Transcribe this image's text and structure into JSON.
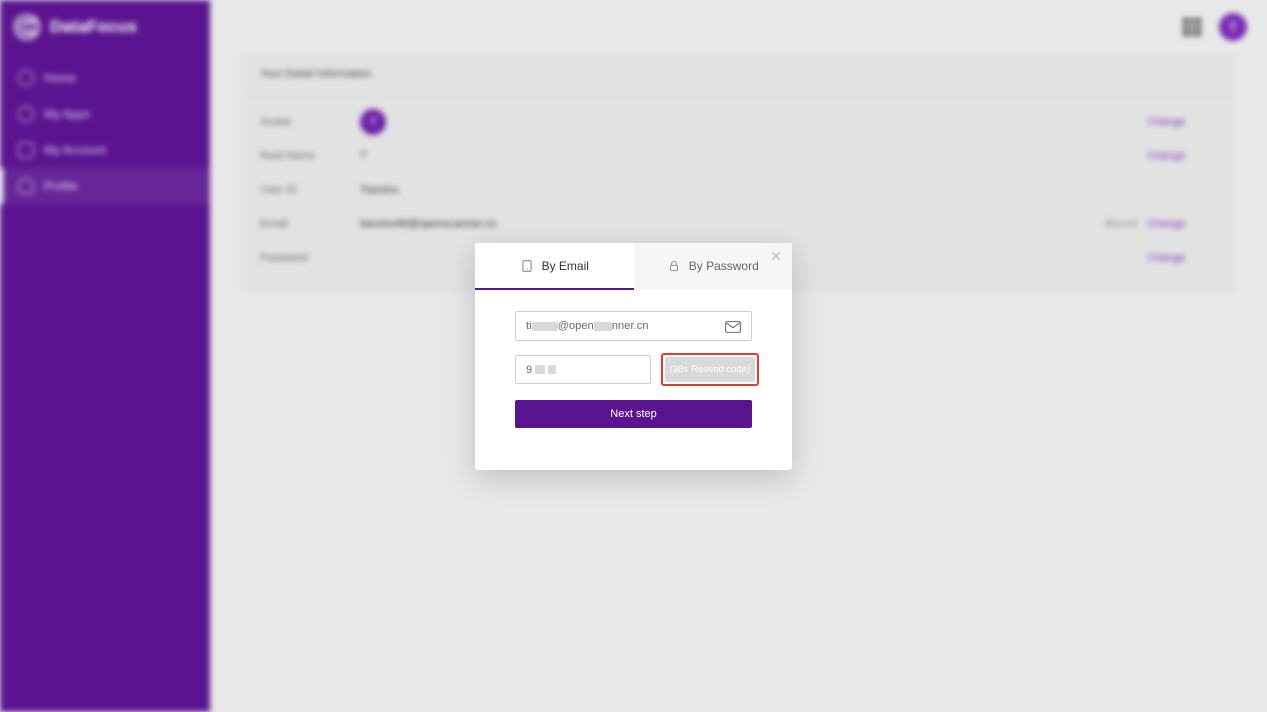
{
  "brand": {
    "name": "DataFocus"
  },
  "sidebar": {
    "items": [
      {
        "label": "Home"
      },
      {
        "label": "My Apps"
      },
      {
        "label": "My Account"
      },
      {
        "label": "Profile"
      }
    ],
    "active_index": 3
  },
  "topbar": {
    "avatar_initial": "T"
  },
  "panel": {
    "title": "Your Detail Information",
    "rows": {
      "avatar": {
        "label": "Avatar",
        "value_initial": "T",
        "action": "Change"
      },
      "realname": {
        "label": "Real Name",
        "value": "T",
        "action": "Change"
      },
      "userid": {
        "label": "User ID",
        "value": "Tianshu"
      },
      "email": {
        "label": "Email",
        "value": "tianshu98@openscanner.cn",
        "status": "Bound",
        "action": "Change"
      },
      "password": {
        "label": "Password",
        "action": "Change"
      }
    }
  },
  "modal": {
    "tabs": {
      "email": "By Email",
      "password": "By Password",
      "active": "email"
    },
    "email_prefix": "ti",
    "email_mid": "@open",
    "email_suffix": "nner.cn",
    "code_prefix": "9",
    "resend_label": "(38s Resend code)",
    "next_label": "Next step"
  },
  "colors": {
    "accent": "#5a148f",
    "highlight_border": "#e33b2e"
  }
}
